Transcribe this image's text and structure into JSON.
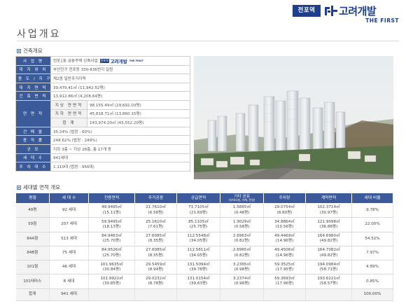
{
  "brand": {
    "badge": "전포역",
    "name": "고려개발",
    "sub": "THE FIRST",
    "minibadge": "전포역"
  },
  "page": {
    "title": "사업개요"
  },
  "overview": {
    "section_label": "건축개요",
    "rows": [
      {
        "key": "사 업 명",
        "value": "전포1동 공동주택 신축사업"
      },
      {
        "key": "대 지 위 치",
        "value": "부산진구 전포동 330-836번지 일원"
      },
      {
        "key": "용 도 / 지 구",
        "value": "제2종 일반주거지역"
      },
      {
        "key": "대 지 면 적",
        "value": "39,479.41㎡ (11,942.52평)"
      },
      {
        "key": "건 축 면 적",
        "value": "13,912.86㎡ (4,208.64평)"
      },
      {
        "key": "연 면 적",
        "sub": [
          {
            "label": "지상 연면적",
            "value": "98,155.49㎡ (29,692.03평)"
          },
          {
            "label": "지하 연면적",
            "value": "45,818.71㎡ (13,860.15평)"
          },
          {
            "label": "합 계",
            "value": "143,974.20㎡ (43,552.20평)"
          }
        ]
      },
      {
        "key": "건 폐 율",
        "value": "35.24% (법정 : 60%)"
      },
      {
        "key": "용 적 률",
        "value": "248.62% (법정 : 249%)"
      },
      {
        "key": "규 모",
        "value": "지하 3층 ~ 지상 28층, 총 17개 동"
      },
      {
        "key": "세 대 수",
        "value": "941세대"
      },
      {
        "key": "주 차 대 수",
        "value": "1,110대 (법정 : 956대)"
      }
    ]
  },
  "units": {
    "section_label": "세대별 면적 개요",
    "headers": [
      "평형",
      "세 대 수",
      "전용면적",
      "주거공용",
      "공급면적",
      "기타 공유",
      "주차장",
      "계약면적",
      "세대 비율"
    ],
    "header_sub": "(부대시설, 기계, 전실)",
    "rows": [
      [
        "49평",
        "92 세대",
        "49.9495㎡",
        "(15.11평)",
        "21.7610㎡",
        "(6.58평)",
        "71.7105㎡",
        "(21.69평)",
        "1.5865㎡",
        "(0.48평)",
        "29.0754㎡",
        "(8.80평)",
        "102.3714㎡",
        "(30.97평)",
        "9.78%"
      ],
      [
        "59형",
        "207 세대",
        "59.9495㎡",
        "(18.13평)",
        "25.1610㎡",
        "(7.61평)",
        "85.1105㎡",
        "(25.75평)",
        "1.9029㎡",
        "(0.58평)",
        "34.8864㎡",
        "(10.56평)",
        "121.9098㎡",
        "(36.88평)",
        "22.00%"
      ],
      [
        "84A형",
        "513 세대",
        "84.9463㎡",
        "(25.70평)",
        "27.6085㎡",
        "(8.35평)",
        "112.5548㎡",
        "(34.05평)",
        "2.6963㎡",
        "(0.82평)",
        "49.4469㎡",
        "(14.96평)",
        "164.6980㎡",
        "(49.82평)",
        "54.52%"
      ],
      [
        "84B형",
        "75 세대",
        "84.9526㎡",
        "(25.70평)",
        "27.6085㎡",
        "(8.35평)",
        "112.5611㎡",
        "(34.05평)",
        "2.6965㎡",
        "(0.82평)",
        "49.4506㎡",
        "(14.96평)",
        "164.7082㎡",
        "(49.82평)",
        "7.97%"
      ],
      [
        "101형",
        "46 세대",
        "101.9635㎡",
        "(30.84평)",
        "29.5459㎡",
        "(8.94평)",
        "131.5094㎡",
        "(39.78평)",
        "3.2365㎡",
        "(0.98평)",
        "59.3525㎡",
        "(17.95평)",
        "194.0984㎡",
        "(58.71평)",
        "4.89%"
      ],
      [
        "101테라스",
        "8 세대",
        "101.9922㎡",
        "(30.85평)",
        "29.0232㎡",
        "(8.78평)",
        "131.0154㎡",
        "(39.63평)",
        "3.2374㎡",
        "(0.98평)",
        "59.3693㎡",
        "(17.96평)",
        "193.6221㎡",
        "(58.57평)",
        "0.85%"
      ]
    ],
    "total": {
      "label": "합계",
      "count": "941 세대",
      "ratio": "100.00%"
    }
  }
}
